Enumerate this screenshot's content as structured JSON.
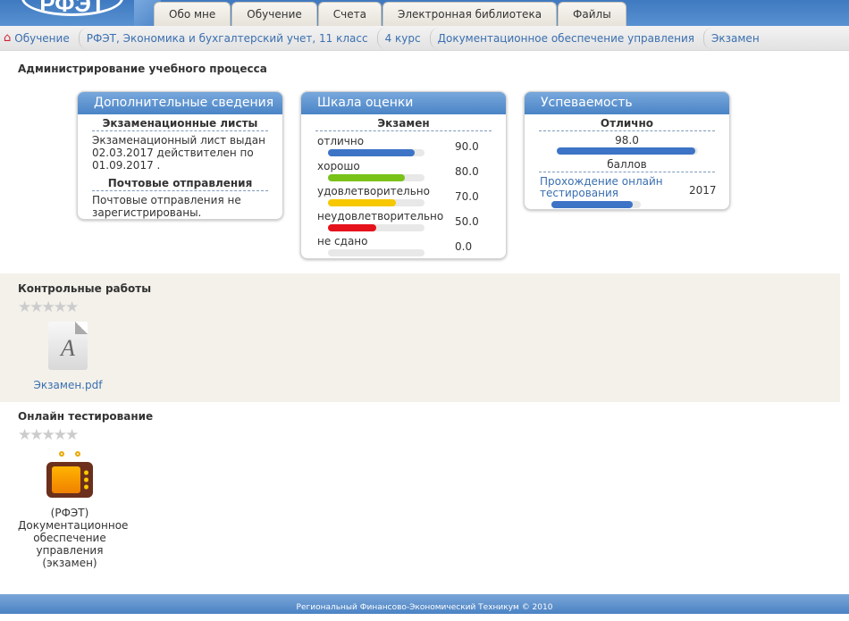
{
  "header": {
    "logo": "РФЭТ",
    "tabs": [
      "Обо мне",
      "Обучение",
      "Счета",
      "Электронная библиотека",
      "Файлы"
    ]
  },
  "breadcrumb": [
    "Обучение",
    "РФЭТ, Экономика и бухгалтерский учет, 11 класс",
    "4 курс",
    "Документационное обеспечение управления",
    "Экзамен"
  ],
  "page_title": "Администрирование учебного процесса",
  "info": {
    "title": "Дополнительные сведения",
    "exam_heading": "Экзаменационные листы",
    "exam_text": "Экзаменационный лист выдан 02.03.2017 действителен по 01.09.2017 .",
    "mail_heading": "Почтовые отправления",
    "mail_text": "Почтовые отправления не зарегистрированы."
  },
  "scale": {
    "title": "Шкала оценки",
    "heading": "Экзамен",
    "rows": [
      {
        "label": "отлично",
        "value": "90.0",
        "fill": 90,
        "color": "#3d74c6"
      },
      {
        "label": "хорошо",
        "value": "80.0",
        "fill": 80,
        "color": "#79c21a"
      },
      {
        "label": "удовлетворительно",
        "value": "70.0",
        "fill": 70,
        "color": "#f7c800"
      },
      {
        "label": "неудовлетворительно",
        "value": "50.0",
        "fill": 50,
        "color": "#e5121c"
      },
      {
        "label": "не сдано",
        "value": "0.0",
        "fill": 0,
        "color": "#ccc"
      }
    ]
  },
  "progress": {
    "title": "Успеваемость",
    "grade": "Отлично",
    "score": "98.0",
    "score_fill": 98,
    "unit": "баллов",
    "link": "Прохождение онлайн тестирования",
    "year": "2017",
    "link_fill": 91
  },
  "control": {
    "title": "Контрольные работы",
    "file": "Экзамен.pdf"
  },
  "online": {
    "title": "Онлайн тестирование",
    "item": "(РФЭТ) Документационное обеспечение управления (экзамен)"
  },
  "footer": "Региональный Финансово-Экономический Техникум © 2010"
}
